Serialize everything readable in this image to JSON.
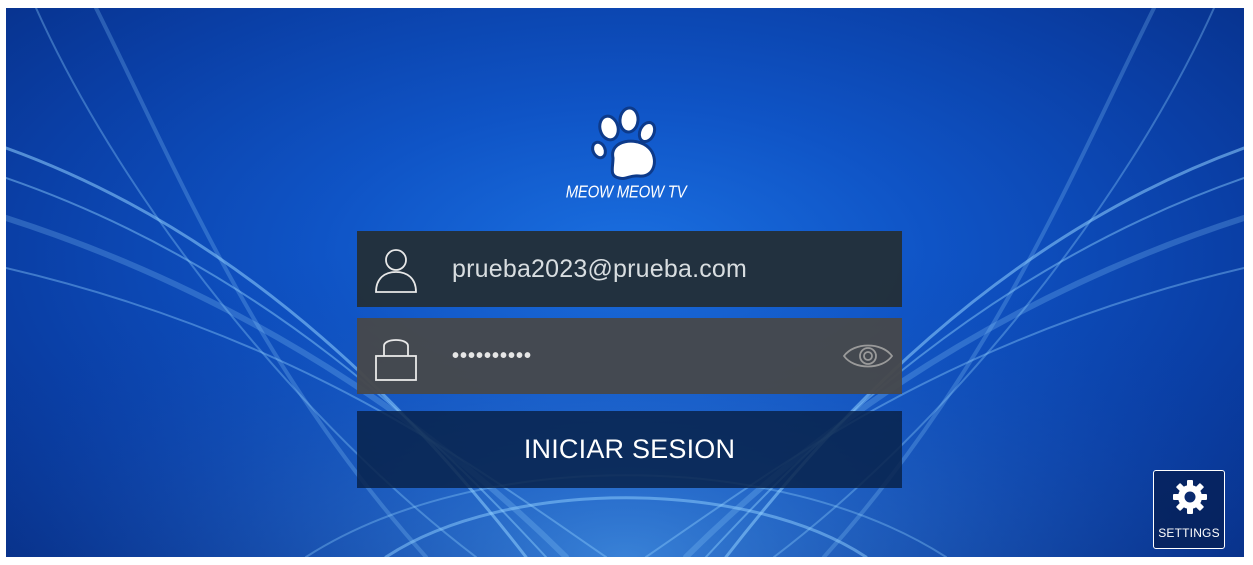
{
  "brand": {
    "logo_icon": "paw-print-icon",
    "name": "MEOW MEOW TV"
  },
  "login": {
    "username_icon": "user-icon",
    "username_value": "prueba2023@prueba.com",
    "password_icon": "lock-icon",
    "password_value": "••••••••••",
    "show_password_icon": "eye-icon",
    "submit_label": "INICIAR SESION"
  },
  "settings": {
    "icon": "gear-icon",
    "label": "SETTINGS"
  },
  "colors": {
    "background": "#0f54c6",
    "username_field": "#23303a",
    "password_field": "#46484c",
    "button": "#08224a"
  }
}
